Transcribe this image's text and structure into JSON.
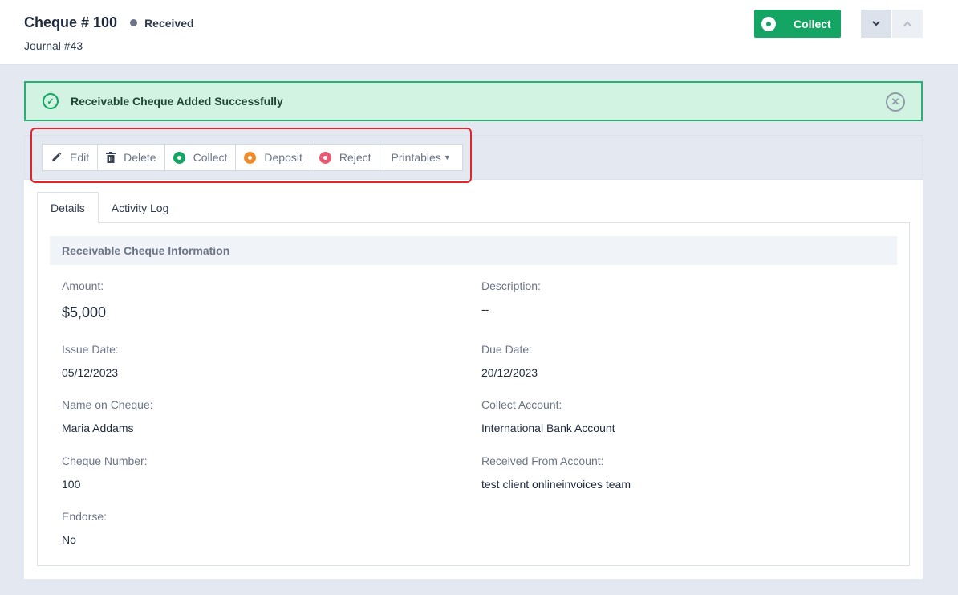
{
  "header": {
    "title": "Cheque # 100",
    "status": "Received",
    "status_color": "#6c7486",
    "journal_link": "Journal #43",
    "collect_button": "Collect",
    "nav": {
      "down_icon": "chevron-down-icon",
      "up_icon": "chevron-up-icon"
    }
  },
  "alert": {
    "message": "Receivable Cheque Added Successfully",
    "icon": "check-circle-icon",
    "close_icon": "close-circle-icon",
    "color": "#14a463"
  },
  "toolbar": {
    "edit": "Edit",
    "delete": "Delete",
    "collect": "Collect",
    "deposit": "Deposit",
    "reject": "Reject",
    "printables": "Printables"
  },
  "tabs": [
    "Details",
    "Activity Log"
  ],
  "section_title": "Receivable Cheque Information",
  "fields": {
    "amount": {
      "label": "Amount:",
      "value": "$5,000"
    },
    "description": {
      "label": "Description:",
      "value": "--"
    },
    "issue_date": {
      "label": "Issue Date:",
      "value": "05/12/2023"
    },
    "due_date": {
      "label": "Due Date:",
      "value": "20/12/2023"
    },
    "name_on_cheque": {
      "label": "Name on Cheque:",
      "value": "Maria Addams"
    },
    "collect_account": {
      "label": "Collect Account:",
      "value": "International Bank Account"
    },
    "cheque_number": {
      "label": "Cheque Number:",
      "value": "100"
    },
    "received_from": {
      "label": "Received From Account:",
      "value": "test client onlineinvoices team"
    },
    "endorse": {
      "label": "Endorse:",
      "value": "No"
    }
  }
}
